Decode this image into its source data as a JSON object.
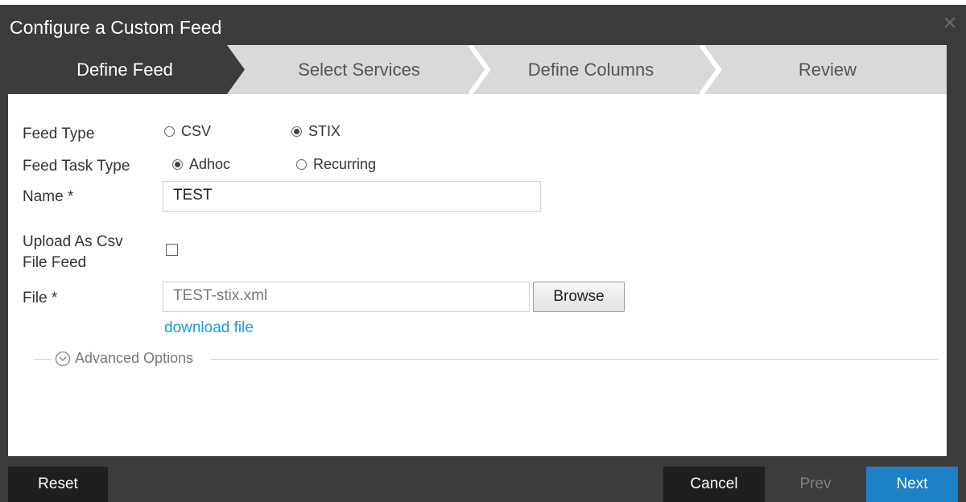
{
  "dialog": {
    "title": "Configure a Custom Feed"
  },
  "steps": [
    {
      "label": "Define Feed",
      "active": true
    },
    {
      "label": "Select Services",
      "active": false
    },
    {
      "label": "Define Columns",
      "active": false
    },
    {
      "label": "Review",
      "active": false
    }
  ],
  "form": {
    "feed_type": {
      "label": "Feed Type",
      "options": [
        {
          "label": "CSV",
          "checked": false
        },
        {
          "label": "STIX",
          "checked": true
        }
      ]
    },
    "feed_task_type": {
      "label": "Feed Task Type",
      "options": [
        {
          "label": "Adhoc",
          "checked": true
        },
        {
          "label": "Recurring",
          "checked": false
        }
      ]
    },
    "name": {
      "label": "Name *",
      "value": "TEST"
    },
    "upload_csv": {
      "label_line1": "Upload As Csv",
      "label_line2": "File Feed",
      "checked": false
    },
    "file": {
      "label": "File *",
      "value": "TEST-stix.xml",
      "browse_label": "Browse",
      "download_link": "download file"
    },
    "advanced": {
      "label": "Advanced Options",
      "icon": "chevron-down-circle-icon"
    }
  },
  "footer": {
    "reset_label": "Reset",
    "cancel_label": "Cancel",
    "prev_label": "Prev",
    "next_label": "Next"
  },
  "colors": {
    "chrome": "#3c3c3c",
    "active_step": "#3c3c3c",
    "inactive_step": "#d9d9d9",
    "primary": "#1b80c4",
    "link": "#1a9ad8"
  }
}
